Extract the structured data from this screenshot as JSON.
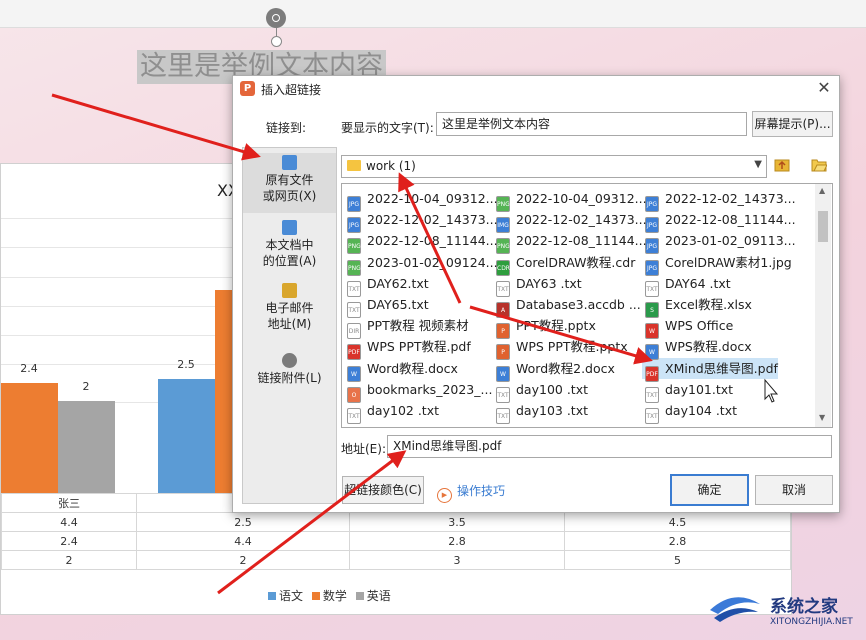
{
  "slide": {
    "text": "这里是举例文本内容"
  },
  "chart": {
    "title": "XX",
    "legend": [
      {
        "name": "语文",
        "color": "#5b9bd5"
      },
      {
        "name": "数学",
        "color": "#ed7d31"
      },
      {
        "name": "英语",
        "color": "#a5a5a5"
      }
    ],
    "bar_labels": [
      "2.4",
      "2",
      "2.5"
    ],
    "table_rows": [
      [
        "张三",
        "",
        "",
        ""
      ],
      [
        "4.4",
        "2.5",
        "3.5",
        "4.5"
      ],
      [
        "2.4",
        "4.4",
        "2.8",
        "2.8"
      ],
      [
        "2",
        "2",
        "3",
        "5"
      ]
    ]
  },
  "dialog": {
    "title": "插入超链接",
    "close": "✕",
    "link_to_label": "链接到:",
    "display_text_label": "要显示的文字(T):",
    "display_text_value": "这里是举例文本内容",
    "screen_tip_button": "屏幕提示(P)...",
    "nav": [
      {
        "label1": "原有文件",
        "label2": "或网页(X)",
        "icon_color": "#4a8bd6"
      },
      {
        "label1": "本文档中",
        "label2": "的位置(A)",
        "icon_color": "#4a8bd6"
      },
      {
        "label1": "电子邮件",
        "label2": "地址(M)",
        "icon_color": "#d9a62c"
      },
      {
        "label1": "链接附件(L)",
        "label2": "",
        "icon_color": "#7b7b7b"
      }
    ],
    "folder": "work (1)",
    "files": [
      {
        "name": "2022-10-04_09312...",
        "icon": "JPG",
        "color": "#3d7fd6"
      },
      {
        "name": "2022-10-04_09312...",
        "icon": "PNG",
        "color": "#55b454"
      },
      {
        "name": "2022-12-02_14373...",
        "icon": "JPG",
        "color": "#3d7fd6"
      },
      {
        "name": "2022-12-02_14373...",
        "icon": "JPG",
        "color": "#3d7fd6"
      },
      {
        "name": "2022-12-02_14373...",
        "icon": "IMG",
        "color": "#3d7fd6"
      },
      {
        "name": "2022-12-08_11144...",
        "icon": "JPG",
        "color": "#3d7fd6"
      },
      {
        "name": "2022-12-08_11144...",
        "icon": "PNG",
        "color": "#55b454"
      },
      {
        "name": "2022-12-08_11144...",
        "icon": "PNG",
        "color": "#55b454"
      },
      {
        "name": "2023-01-02_09113...",
        "icon": "JPG",
        "color": "#3d7fd6"
      },
      {
        "name": "2023-01-02_09124...",
        "icon": "PNG",
        "color": "#55b454"
      },
      {
        "name": "CorelDRAW教程.cdr",
        "icon": "CDR",
        "color": "#2e9e3e"
      },
      {
        "name": "CorelDRAW素材1.jpg",
        "icon": "JPG",
        "color": "#3d7fd6"
      },
      {
        "name": "DAY62.txt",
        "icon": "TXT",
        "color": "#ffffff"
      },
      {
        "name": "DAY63 .txt",
        "icon": "TXT",
        "color": "#ffffff"
      },
      {
        "name": "DAY64 .txt",
        "icon": "TXT",
        "color": "#ffffff"
      },
      {
        "name": "DAY65.txt",
        "icon": "TXT",
        "color": "#ffffff"
      },
      {
        "name": "Database3.accdb ...",
        "icon": "A",
        "color": "#b7322b"
      },
      {
        "name": "Excel教程.xlsx",
        "icon": "S",
        "color": "#2b9a4b"
      },
      {
        "name": "PPT教程 视频素材",
        "icon": "DIR",
        "color": "#ffffff"
      },
      {
        "name": "PPT教程.pptx",
        "icon": "P",
        "color": "#e0622f"
      },
      {
        "name": "WPS Office",
        "icon": "W",
        "color": "#d9342b"
      },
      {
        "name": "WPS PPT教程.pdf",
        "icon": "PDF",
        "color": "#d9342b"
      },
      {
        "name": "WPS PPT教程.pptx",
        "icon": "P",
        "color": "#e0622f"
      },
      {
        "name": "WPS教程.docx",
        "icon": "W",
        "color": "#3d7fd6"
      },
      {
        "name": "Word教程.docx",
        "icon": "W",
        "color": "#3d7fd6"
      },
      {
        "name": "Word教程2.docx",
        "icon": "W",
        "color": "#3d7fd6"
      },
      {
        "name": "XMind思维导图.pdf",
        "icon": "PDF",
        "color": "#d9342b"
      },
      {
        "name": "bookmarks_2023_...",
        "icon": "O",
        "color": "#e8734a"
      },
      {
        "name": "day100 .txt",
        "icon": "TXT",
        "color": "#ffffff"
      },
      {
        "name": "day101.txt",
        "icon": "TXT",
        "color": "#ffffff"
      },
      {
        "name": "day102 .txt",
        "icon": "TXT",
        "color": "#ffffff"
      },
      {
        "name": "day103 .txt",
        "icon": "TXT",
        "color": "#ffffff"
      },
      {
        "name": "day104 .txt",
        "icon": "TXT",
        "color": "#ffffff"
      }
    ],
    "address_label": "地址(E):",
    "address_value": "XMind思维导图.pdf",
    "link_color_button": "超链接颜色(C)",
    "tips_link": "操作技巧",
    "ok_button": "确定",
    "cancel_button": "取消"
  },
  "watermark": {
    "title": "系统之家",
    "subtitle": "XITONGZHIJIA.NET"
  }
}
